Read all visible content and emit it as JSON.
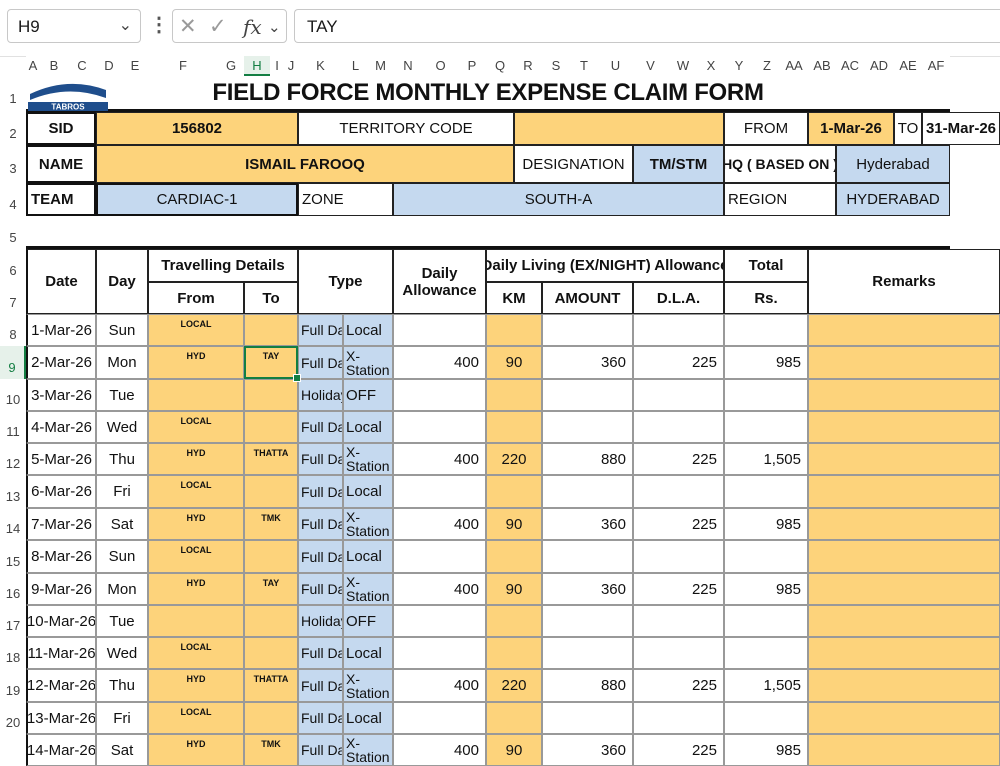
{
  "formula_bar": {
    "name_box": "H9",
    "name_box_chevron": "chevron-down-icon",
    "more_icon": "vertical-ellipsis-icon",
    "cancel_icon": "close-icon",
    "enter_icon": "check-icon",
    "function_label": "fx",
    "function_chevron": "chevron-down-icon",
    "content": "TAY"
  },
  "column_headers": [
    "A",
    "B",
    "C",
    "D",
    "E",
    "F",
    "G",
    "H",
    "I",
    "J",
    "K",
    "L",
    "M",
    "N",
    "O",
    "P",
    "Q",
    "R",
    "S",
    "T",
    "U",
    "V",
    "W",
    "X",
    "Y",
    "Z",
    "AA",
    "AB",
    "AC",
    "AD",
    "AE",
    "AF"
  ],
  "row_headers": [
    "1",
    "2",
    "3",
    "4",
    "5",
    "6",
    "7",
    "8",
    "9",
    "10",
    "11",
    "12",
    "13",
    "14",
    "15",
    "16",
    "17",
    "18",
    "19",
    "20"
  ],
  "selected": {
    "column": "H",
    "row": "9"
  },
  "logo_text": "TABROS",
  "title": "FIELD FORCE MONTHLY EXPENSE CLAIM FORM",
  "info": {
    "sid_label": "SID",
    "sid_value": "156802",
    "territory_label": "TERRITORY CODE",
    "territory_value": "",
    "from_label": "FROM",
    "from_value": "1-Mar-26",
    "to_label": "TO",
    "to_value": "31-Mar-26",
    "name_label": "NAME",
    "name_value": "ISMAIL FAROOQ",
    "designation_label": "DESIGNATION",
    "designation_value": "TM/STM",
    "hq_label": "HQ ( BASED ON )",
    "hq_value": "Hyderabad",
    "team_label": "TEAM",
    "team_value": "CARDIAC-1",
    "zone_label": "ZONE",
    "zone_value": "SOUTH-A",
    "region_label": "REGION",
    "region_value": "HYDERABAD"
  },
  "table_headers": {
    "date": "Date",
    "day": "Day",
    "travelling": "Travelling Details",
    "from": "From",
    "to": "To",
    "type": "Type",
    "daily_allowance_1": "Daily",
    "daily_allowance_2": "Allowance",
    "living": "Daily Living (EX/NIGHT) Allowance",
    "km": "KM",
    "amount": "AMOUNT",
    "dla": "D.L.A.",
    "total": "Total",
    "rs": "Rs.",
    "remarks": "Remarks"
  },
  "rows": [
    {
      "date": "1-Mar-26",
      "day": "Sun",
      "from": "LOCAL",
      "to": "",
      "type1": "Full Day",
      "type2": "Local",
      "da": "",
      "km": "",
      "amount": "",
      "dla": "",
      "total": ""
    },
    {
      "date": "2-Mar-26",
      "day": "Mon",
      "from": "HYD",
      "to": "TAY",
      "type1": "Full Day",
      "type2": "X-Station",
      "da": "400",
      "km": "90",
      "amount": "360",
      "dla": "225",
      "total": "985"
    },
    {
      "date": "3-Mar-26",
      "day": "Tue",
      "from": "",
      "to": "",
      "type1": "Holiday",
      "type2": "OFF",
      "da": "",
      "km": "",
      "amount": "",
      "dla": "",
      "total": ""
    },
    {
      "date": "4-Mar-26",
      "day": "Wed",
      "from": "LOCAL",
      "to": "",
      "type1": "Full Day",
      "type2": "Local",
      "da": "",
      "km": "",
      "amount": "",
      "dla": "",
      "total": ""
    },
    {
      "date": "5-Mar-26",
      "day": "Thu",
      "from": "HYD",
      "to": "THATTA",
      "type1": "Full Day",
      "type2": "X-Station",
      "da": "400",
      "km": "220",
      "amount": "880",
      "dla": "225",
      "total": "1,505"
    },
    {
      "date": "6-Mar-26",
      "day": "Fri",
      "from": "LOCAL",
      "to": "",
      "type1": "Full Day",
      "type2": "Local",
      "da": "",
      "km": "",
      "amount": "",
      "dla": "",
      "total": ""
    },
    {
      "date": "7-Mar-26",
      "day": "Sat",
      "from": "HYD",
      "to": "TMK",
      "type1": "Full Day",
      "type2": "X-Station",
      "da": "400",
      "km": "90",
      "amount": "360",
      "dla": "225",
      "total": "985"
    },
    {
      "date": "8-Mar-26",
      "day": "Sun",
      "from": "LOCAL",
      "to": "",
      "type1": "Full Day",
      "type2": "Local",
      "da": "",
      "km": "",
      "amount": "",
      "dla": "",
      "total": ""
    },
    {
      "date": "9-Mar-26",
      "day": "Mon",
      "from": "HYD",
      "to": "TAY",
      "type1": "Full Day",
      "type2": "X-Station",
      "da": "400",
      "km": "90",
      "amount": "360",
      "dla": "225",
      "total": "985"
    },
    {
      "date": "10-Mar-26",
      "day": "Tue",
      "from": "",
      "to": "",
      "type1": "Holiday",
      "type2": "OFF",
      "da": "",
      "km": "",
      "amount": "",
      "dla": "",
      "total": ""
    },
    {
      "date": "11-Mar-26",
      "day": "Wed",
      "from": "LOCAL",
      "to": "",
      "type1": "Full Day",
      "type2": "Local",
      "da": "",
      "km": "",
      "amount": "",
      "dla": "",
      "total": ""
    },
    {
      "date": "12-Mar-26",
      "day": "Thu",
      "from": "HYD",
      "to": "THATTA",
      "type1": "Full Day",
      "type2": "X-Station",
      "da": "400",
      "km": "220",
      "amount": "880",
      "dla": "225",
      "total": "1,505"
    },
    {
      "date": "13-Mar-26",
      "day": "Fri",
      "from": "LOCAL",
      "to": "",
      "type1": "Full Day",
      "type2": "Local",
      "da": "",
      "km": "",
      "amount": "",
      "dla": "",
      "total": ""
    },
    {
      "date": "14-Mar-26",
      "day": "Sat",
      "from": "HYD",
      "to": "TMK",
      "type1": "Full Day",
      "type2": "X-Station",
      "da": "400",
      "km": "90",
      "amount": "360",
      "dla": "225",
      "total": "985"
    }
  ],
  "colors": {
    "yellow_fill": "#fdd37b",
    "blue_fill": "#c5d9ef",
    "selection_green": "#137e43",
    "logo_blue": "#1f4e8c"
  }
}
